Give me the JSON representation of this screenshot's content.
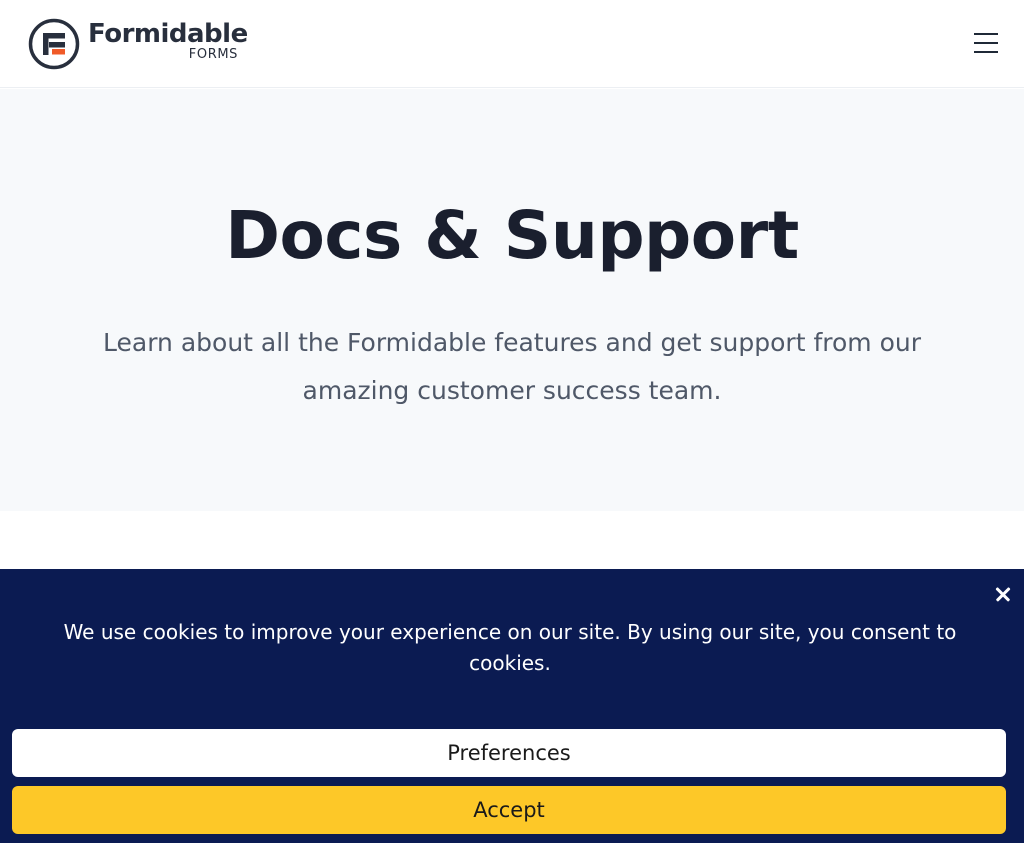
{
  "header": {
    "logo_word": "Formidable",
    "logo_sub": "FORMS",
    "menu_icon": "hamburger-menu-icon"
  },
  "hero": {
    "title": "Docs & Support",
    "description": "Learn about all the Formidable features and get support from our amazing customer success team."
  },
  "cookie_banner": {
    "message": "We use cookies to improve your experience on our site. By using our site, you consent to cookies.",
    "preferences_label": "Preferences",
    "accept_label": "Accept",
    "close_icon": "close-icon"
  },
  "colors": {
    "brand_dark": "#282f3d",
    "brand_accent": "#f05a28",
    "banner_bg": "#0b1b52",
    "accept_bg": "#fdc828",
    "hero_bg": "#f7f9fb"
  }
}
